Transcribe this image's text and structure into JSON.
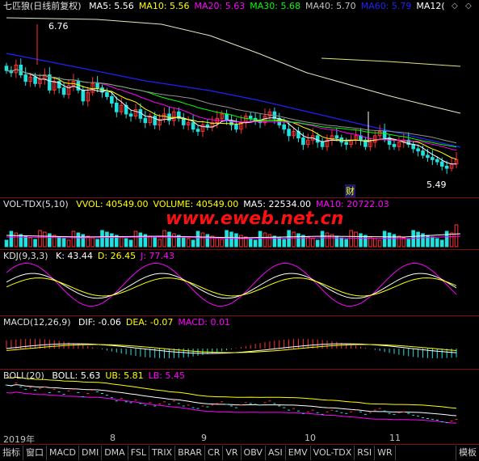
{
  "main": {
    "title": "七匹狼(日线前复权)",
    "ma": [
      {
        "label": "MA5: 5.56",
        "color": "#ffffff"
      },
      {
        "label": "MA10: 5.56",
        "color": "#ffff00"
      },
      {
        "label": "MA20: 5.63",
        "color": "#ff00ff"
      },
      {
        "label": "MA30: 5.68",
        "color": "#00ff00"
      },
      {
        "label": "MA40: 5.70",
        "color": "#c0c0c0"
      },
      {
        "label": "MA60: 5.79",
        "color": "#2020ff"
      },
      {
        "label": "MA12(",
        "color": "#ffffff"
      }
    ],
    "high_label": "6.76",
    "low_label": "5.49",
    "cai_label": "财",
    "ylim": [
      5.3,
      6.9
    ],
    "candles": [
      6.4,
      6.38,
      6.45,
      6.36,
      6.3,
      6.34,
      6.28,
      6.32,
      6.36,
      6.22,
      6.3,
      6.24,
      6.18,
      6.26,
      6.3,
      6.22,
      6.12,
      6.2,
      6.28,
      6.24,
      6.2,
      6.16,
      6.1,
      6.02,
      6.08,
      6.0,
      5.98,
      6.04,
      5.96,
      5.92,
      5.98,
      5.9,
      5.95,
      6.0,
      5.94,
      6.02,
      5.96,
      5.9,
      5.92,
      5.86,
      5.84,
      5.9,
      5.88,
      5.92,
      5.96,
      6.0,
      5.94,
      5.9,
      5.86,
      5.92,
      5.98,
      5.96,
      5.94,
      5.92,
      5.98,
      6.02,
      5.96,
      5.9,
      5.86,
      5.8,
      5.84,
      5.78,
      5.72,
      5.76,
      5.8,
      5.74,
      5.7,
      5.76,
      5.8,
      5.78,
      5.74,
      5.72,
      5.76,
      5.8,
      5.76,
      5.7,
      5.74,
      5.8,
      5.84,
      5.78,
      5.72,
      5.7,
      5.74,
      5.76,
      5.72,
      5.68,
      5.66,
      5.62,
      5.6,
      5.58,
      5.56,
      5.52,
      5.5,
      5.54,
      5.58
    ]
  },
  "vol": {
    "title": "VOL-TDX(5,10)",
    "items": [
      {
        "label": "VVOL: 40549.00",
        "color": "#ffff00"
      },
      {
        "label": "VOLUME: 40549.00",
        "color": "#ffff00"
      },
      {
        "label": "MA5: 22534.00",
        "color": "#ffffff"
      },
      {
        "label": "MA10: 20722.03",
        "color": "#ff00ff"
      }
    ]
  },
  "watermark": "www.eweb.net.cn",
  "kdj": {
    "title": "KDJ(9,3,3)",
    "items": [
      {
        "label": "K: 43.44",
        "color": "#ffffff"
      },
      {
        "label": "D: 26.45",
        "color": "#ffff00"
      },
      {
        "label": "J: 77.43",
        "color": "#ff00ff"
      }
    ]
  },
  "macd": {
    "title": "MACD(12,26,9)",
    "items": [
      {
        "label": "DIF: -0.06",
        "color": "#ffffff"
      },
      {
        "label": "DEA: -0.07",
        "color": "#ffff00"
      },
      {
        "label": "MACD: 0.01",
        "color": "#ff00ff"
      }
    ]
  },
  "boll": {
    "title": "BOLL(20)",
    "items": [
      {
        "label": "BOLL: 5.63",
        "color": "#ffffff"
      },
      {
        "label": "UB: 5.81",
        "color": "#ffff00"
      },
      {
        "label": "LB: 5.45",
        "color": "#ff00ff"
      }
    ]
  },
  "axis_labels": [
    "2019年",
    "8",
    "9",
    "10",
    "11"
  ],
  "tabs": [
    "指标",
    "窗口",
    "MACD",
    "DMI",
    "DMA",
    "FSL",
    "TRIX",
    "BRAR",
    "CR",
    "VR",
    "OBV",
    "ASI",
    "EMV",
    "VOL-TDX",
    "RSI",
    "WR"
  ],
  "tab_right": "模板"
}
